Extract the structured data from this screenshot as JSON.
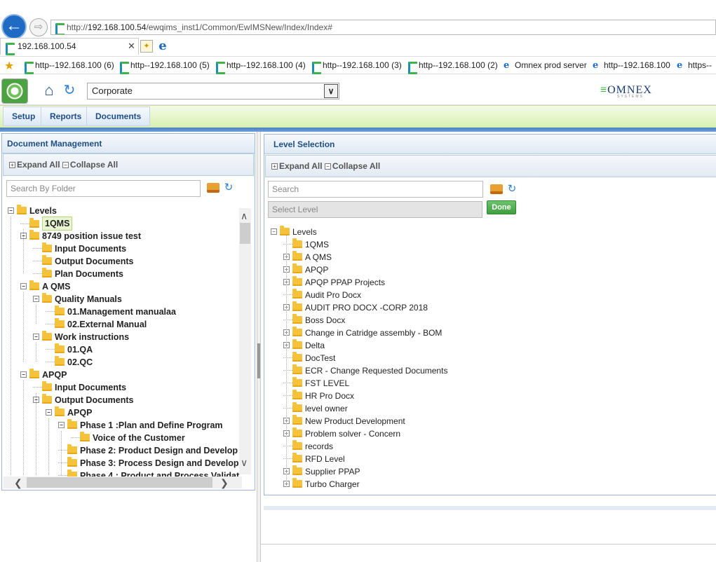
{
  "browser": {
    "url_prefix": "http://",
    "url_host": "192.168.100.54",
    "url_path": "/ewqims_inst1/Common/EwIMSNew/Index/Index#",
    "tab_title": "192.168.100.54",
    "favorites": [
      {
        "label": "http--192.168.100 (6)",
        "icon": "omnex-favicon"
      },
      {
        "label": "http--192.168.100 (5)",
        "icon": "omnex-favicon"
      },
      {
        "label": "http--192.168.100 (4)",
        "icon": "omnex-favicon"
      },
      {
        "label": "http--192.168.100 (3)",
        "icon": "omnex-favicon"
      },
      {
        "label": "http--192.168.100 (2)",
        "icon": "omnex-favicon"
      },
      {
        "label": "Omnex prod server",
        "icon": "ie-favicon"
      },
      {
        "label": "http--192.168.100",
        "icon": "ie-favicon"
      },
      {
        "label": "https--",
        "icon": "ie-favicon"
      }
    ]
  },
  "header": {
    "corporate_select": "Corporate",
    "logo_text": "OMNEX",
    "logo_sub": "SYSTEMS"
  },
  "menu": [
    "Setup",
    "Reports",
    "Documents"
  ],
  "left_panel": {
    "title": "Document Management",
    "expand_all": "Expand All",
    "collapse_all": "Collapse All",
    "search_placeholder": "Search By Folder",
    "tree": [
      {
        "label": "Levels",
        "depth": 0,
        "toggle": "minus"
      },
      {
        "label": "1QMS",
        "depth": 1,
        "toggle": "none",
        "selected": true
      },
      {
        "label": "8749 position issue test",
        "depth": 1,
        "toggle": "minus"
      },
      {
        "label": "Input Documents",
        "depth": 2,
        "toggle": "none"
      },
      {
        "label": "Output Documents",
        "depth": 2,
        "toggle": "none"
      },
      {
        "label": "Plan Documents",
        "depth": 2,
        "toggle": "none"
      },
      {
        "label": "A QMS",
        "depth": 1,
        "toggle": "minus"
      },
      {
        "label": "Quality Manuals",
        "depth": 2,
        "toggle": "minus"
      },
      {
        "label": "01.Management manualaa",
        "depth": 3,
        "toggle": "none"
      },
      {
        "label": "02.External Manual",
        "depth": 3,
        "toggle": "none"
      },
      {
        "label": "Work instructions",
        "depth": 2,
        "toggle": "minus"
      },
      {
        "label": "01.QA",
        "depth": 3,
        "toggle": "none"
      },
      {
        "label": "02.QC",
        "depth": 3,
        "toggle": "none"
      },
      {
        "label": "APQP",
        "depth": 1,
        "toggle": "minus"
      },
      {
        "label": "Input Documents",
        "depth": 2,
        "toggle": "none"
      },
      {
        "label": "Output Documents",
        "depth": 2,
        "toggle": "minus"
      },
      {
        "label": "APQP",
        "depth": 3,
        "toggle": "minus"
      },
      {
        "label": "Phase 1 :Plan and Define Program",
        "depth": 4,
        "toggle": "minus"
      },
      {
        "label": "Voice of the Customer",
        "depth": 5,
        "toggle": "none"
      },
      {
        "label": "Phase 2: Product Design and Develop",
        "depth": 4,
        "toggle": "none"
      },
      {
        "label": "Phase 3: Process Design and Develop",
        "depth": 4,
        "toggle": "none"
      },
      {
        "label": "Phase 4 : Product and Process Validat",
        "depth": 4,
        "toggle": "none"
      }
    ]
  },
  "right_panel": {
    "title": "Level Selection",
    "expand_all": "Expand All",
    "collapse_all": "Collapse All",
    "search_placeholder": "Search",
    "select_level_placeholder": "Select Level",
    "done_label": "Done",
    "tree_root": "Levels",
    "tree": [
      {
        "label": "1QMS",
        "toggle": "none"
      },
      {
        "label": "A QMS",
        "toggle": "plus"
      },
      {
        "label": "APQP",
        "toggle": "plus"
      },
      {
        "label": "APQP PPAP Projects",
        "toggle": "plus"
      },
      {
        "label": "Audit Pro Docx",
        "toggle": "none"
      },
      {
        "label": "AUDIT PRO DOCX -CORP 2018",
        "toggle": "plus"
      },
      {
        "label": "Boss Docx",
        "toggle": "none"
      },
      {
        "label": "Change in Catridge assembly - BOM",
        "toggle": "plus"
      },
      {
        "label": "Delta",
        "toggle": "plus"
      },
      {
        "label": "DocTest",
        "toggle": "none"
      },
      {
        "label": "ECR - Change Requested Documents",
        "toggle": "none"
      },
      {
        "label": "FST LEVEL",
        "toggle": "none"
      },
      {
        "label": "HR Pro Docx",
        "toggle": "none"
      },
      {
        "label": "level owner",
        "toggle": "none"
      },
      {
        "label": "New Product Development",
        "toggle": "plus"
      },
      {
        "label": "Problem solver - Concern",
        "toggle": "plus"
      },
      {
        "label": "records",
        "toggle": "none"
      },
      {
        "label": "RFD Level",
        "toggle": "none"
      },
      {
        "label": "Supplier PPAP",
        "toggle": "plus"
      },
      {
        "label": "Turbo Charger",
        "toggle": "plus"
      }
    ]
  }
}
